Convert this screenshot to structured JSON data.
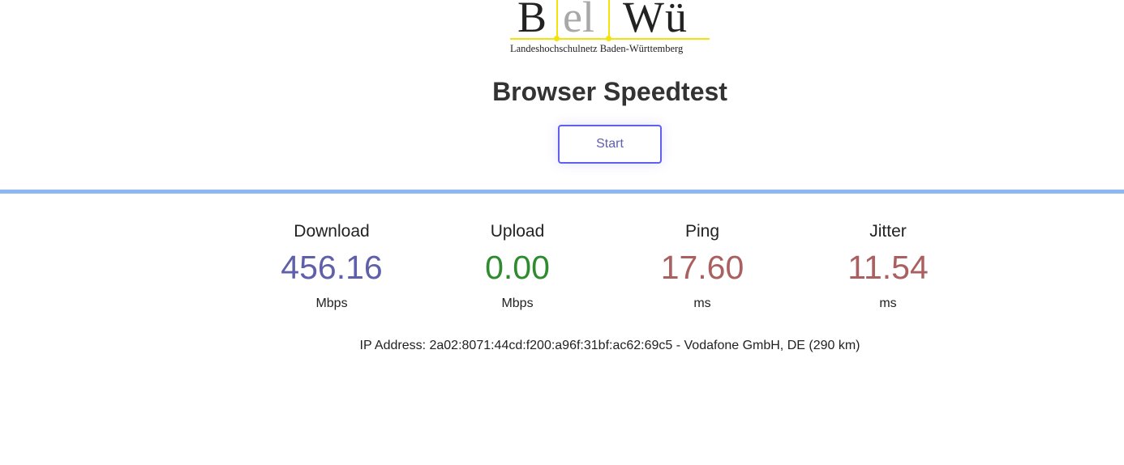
{
  "logo": {
    "letter_b": "B",
    "letter_el": "el",
    "letter_wu": "Wü",
    "tagline": "Landeshochschulnetz Baden-Württemberg",
    "colors": {
      "primary": "#222222",
      "secondary": "#a8a8a8",
      "grid": "#f5e20a"
    }
  },
  "title": "Browser Speedtest",
  "start_button": {
    "label": "Start",
    "border_color": "#6060ee"
  },
  "divider_color": "#8eb8f0",
  "metrics": {
    "download": {
      "label": "Download",
      "value": "456.16",
      "unit": "Mbps",
      "color": "#6060aa"
    },
    "upload": {
      "label": "Upload",
      "value": "0.00",
      "unit": "Mbps",
      "color": "#2e8b2e"
    },
    "ping": {
      "label": "Ping",
      "value": "17.60",
      "unit": "ms",
      "color": "#aa6060"
    },
    "jitter": {
      "label": "Jitter",
      "value": "11.54",
      "unit": "ms",
      "color": "#aa6060"
    }
  },
  "ip_info": "IP Address: 2a02:8071:44cd:f200:a96f:31bf:ac62:69c5 - Vodafone GmbH, DE (290 km)"
}
